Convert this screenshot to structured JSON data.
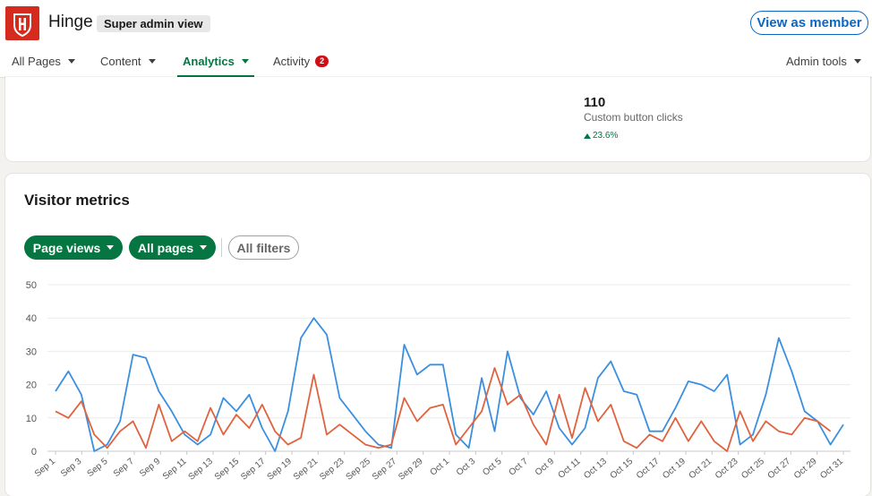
{
  "header": {
    "org_name": "Hinge",
    "badge": "Super admin view",
    "view_as_member": "View as member"
  },
  "nav": {
    "all_pages": "All Pages",
    "content": "Content",
    "analytics": "Analytics",
    "activity": "Activity",
    "activity_count": "2",
    "admin_tools": "Admin tools"
  },
  "highlight": {
    "value": "110",
    "label": "Custom button clicks",
    "change": "23.6%"
  },
  "visitor_metrics": {
    "title": "Visitor metrics",
    "filters": {
      "page_views": "Page views",
      "all_pages": "All pages",
      "all_filters": "All filters"
    }
  },
  "colors": {
    "brand_red": "#d52b1e",
    "linkedin_green": "#057642",
    "linkedin_blue": "#0a66c2",
    "series_blue": "#3b8fe0",
    "series_orange": "#e0623f"
  },
  "chart_data": {
    "type": "line",
    "ylim": [
      0,
      50
    ],
    "yticks": [
      0,
      10,
      20,
      30,
      40,
      50
    ],
    "x_tick_labels": [
      "Sep 1",
      "Sep 3",
      "Sep 5",
      "Sep 7",
      "Sep 9",
      "Sep 11",
      "Sep 13",
      "Sep 15",
      "Sep 17",
      "Sep 19",
      "Sep 21",
      "Sep 23",
      "Sep 25",
      "Sep 27",
      "Sep 29",
      "Oct 1",
      "Oct 3",
      "Oct 5",
      "Oct 7",
      "Oct 9",
      "Oct 11",
      "Oct 13",
      "Oct 15",
      "Oct 17",
      "Oct 19",
      "Oct 21",
      "Oct 23",
      "Oct 25",
      "Oct 27",
      "Oct 29",
      "Oct 31"
    ],
    "series": [
      {
        "color": "#3b8fe0",
        "values": [
          18,
          24,
          17,
          0,
          2,
          9,
          29,
          28,
          18,
          12,
          5,
          2,
          5,
          16,
          12,
          17,
          7,
          0,
          12,
          34,
          40,
          35,
          16,
          11,
          6,
          2,
          1,
          32,
          23,
          26,
          26,
          5,
          1,
          22,
          6,
          30,
          16,
          11,
          18,
          7,
          2,
          7,
          22,
          27,
          18,
          17,
          6,
          6,
          13,
          21,
          20,
          18,
          23,
          2,
          5,
          17,
          34,
          24,
          12,
          9,
          2,
          8
        ]
      },
      {
        "color": "#e0623f",
        "values": [
          12,
          10,
          15,
          5,
          1,
          6,
          9,
          1,
          14,
          3,
          6,
          3,
          13,
          5,
          11,
          7,
          14,
          6,
          2,
          4,
          23,
          5,
          8,
          5,
          2,
          1,
          2,
          16,
          9,
          13,
          14,
          2,
          7,
          12,
          25,
          14,
          17,
          8,
          2,
          17,
          4,
          19,
          9,
          14,
          3,
          1,
          5,
          3,
          10,
          3,
          9,
          3,
          0,
          12,
          3,
          9,
          6,
          5,
          10,
          9,
          6
        ]
      }
    ]
  }
}
